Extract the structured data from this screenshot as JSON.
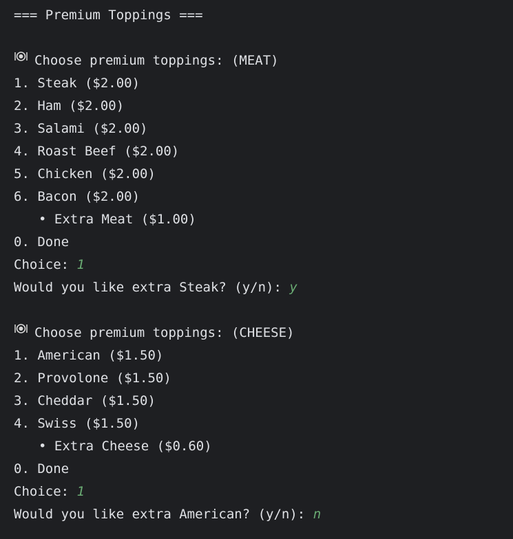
{
  "console": {
    "header": "=== Premium Toppings ===",
    "sections": [
      {
        "icon": "plate-cutlery-icon",
        "title": "Choose premium toppings: (MEAT)",
        "options": [
          "1. Steak ($2.00)",
          "2. Ham ($2.00)",
          "3. Salami ($2.00)",
          "4. Roast Beef ($2.00)",
          "5. Chicken ($2.00)",
          "6. Bacon ($2.00)"
        ],
        "extra": "• Extra Meat ($1.00)",
        "done": "0. Done",
        "choice_prompt": "Choice: ",
        "choice_value": "1",
        "extra_prompt": "Would you like extra Steak? (y/n): ",
        "extra_value": "y"
      },
      {
        "icon": "plate-cutlery-icon",
        "title": "Choose premium toppings: (CHEESE)",
        "options": [
          "1. American ($1.50)",
          "2. Provolone ($1.50)",
          "3. Cheddar ($1.50)",
          "4. Swiss ($1.50)"
        ],
        "extra": "• Extra Cheese ($0.60)",
        "done": "0. Done",
        "choice_prompt": "Choice: ",
        "choice_value": "1",
        "extra_prompt": "Would you like extra American? (y/n): ",
        "extra_value": "n"
      }
    ]
  },
  "colors": {
    "background": "#1e1f22",
    "text": "#dfe1e5",
    "user_input": "#6aab73"
  }
}
